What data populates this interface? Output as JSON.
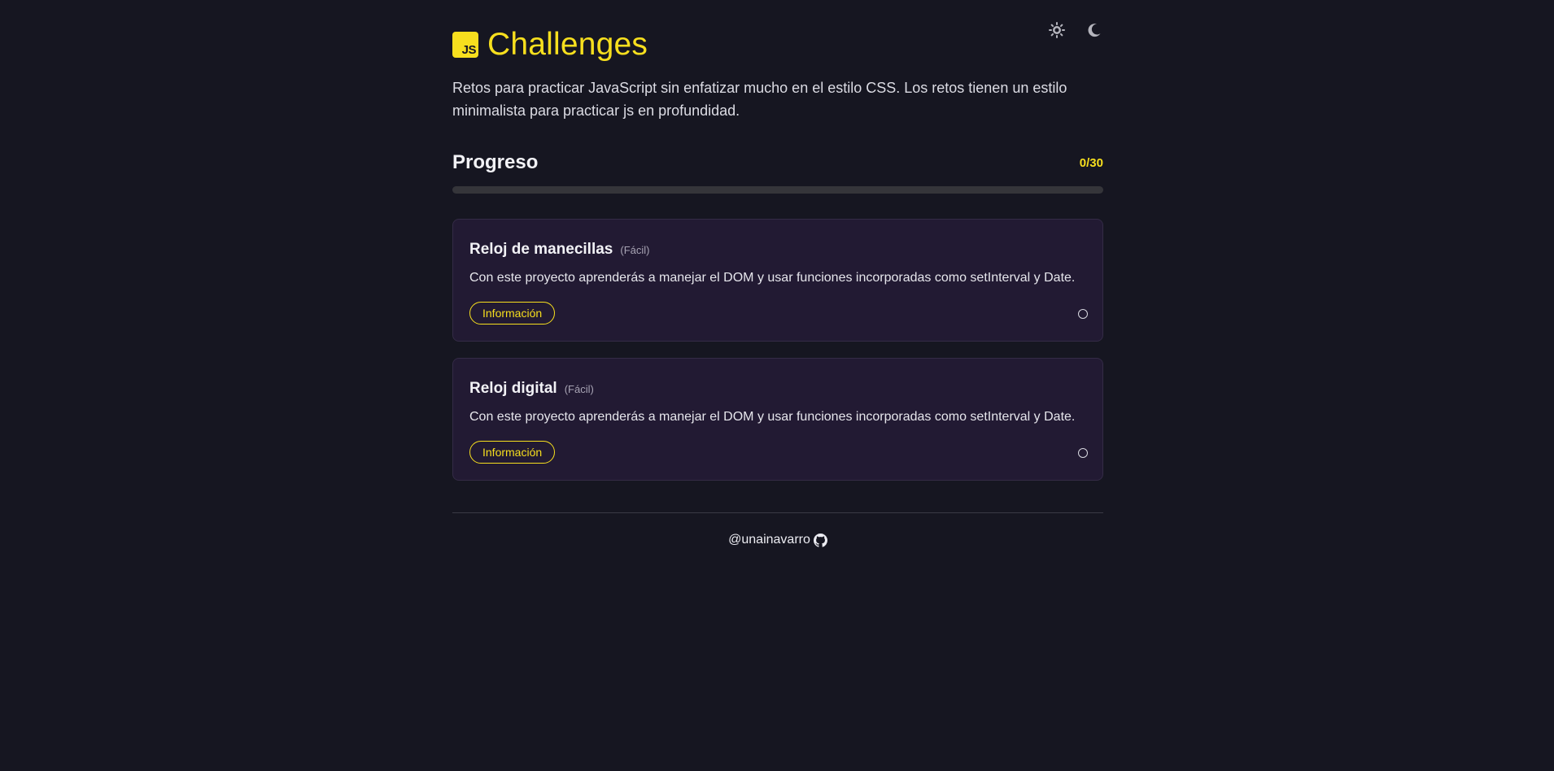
{
  "header": {
    "logo_text": "JS",
    "title": "Challenges",
    "theme_light_icon": "sun-icon",
    "theme_dark_icon": "moon-icon"
  },
  "intro": {
    "description": "Retos para practicar JavaScript sin enfatizar mucho en el estilo CSS. Los retos tienen un estilo minimalista para practicar js en profundidad."
  },
  "progress": {
    "title": "Progreso",
    "count_label": "0/30",
    "completed": 0,
    "total": 30
  },
  "challenges": [
    {
      "title": "Reloj de manecillas",
      "difficulty": "(Fácil)",
      "description": "Con este proyecto aprenderás a manejar el DOM y usar funciones incorporadas como setInterval y Date.",
      "button_label": "Información",
      "completed": false
    },
    {
      "title": "Reloj digital",
      "difficulty": "(Fácil)",
      "description": "Con este proyecto aprenderás a manejar el DOM y usar funciones incorporadas como setInterval y Date.",
      "button_label": "Información",
      "completed": false
    }
  ],
  "footer": {
    "author": "@unainavarro",
    "icon": "github-icon"
  },
  "colors": {
    "accent": "#f7df1e",
    "background": "#161621",
    "card": "#221a33"
  }
}
